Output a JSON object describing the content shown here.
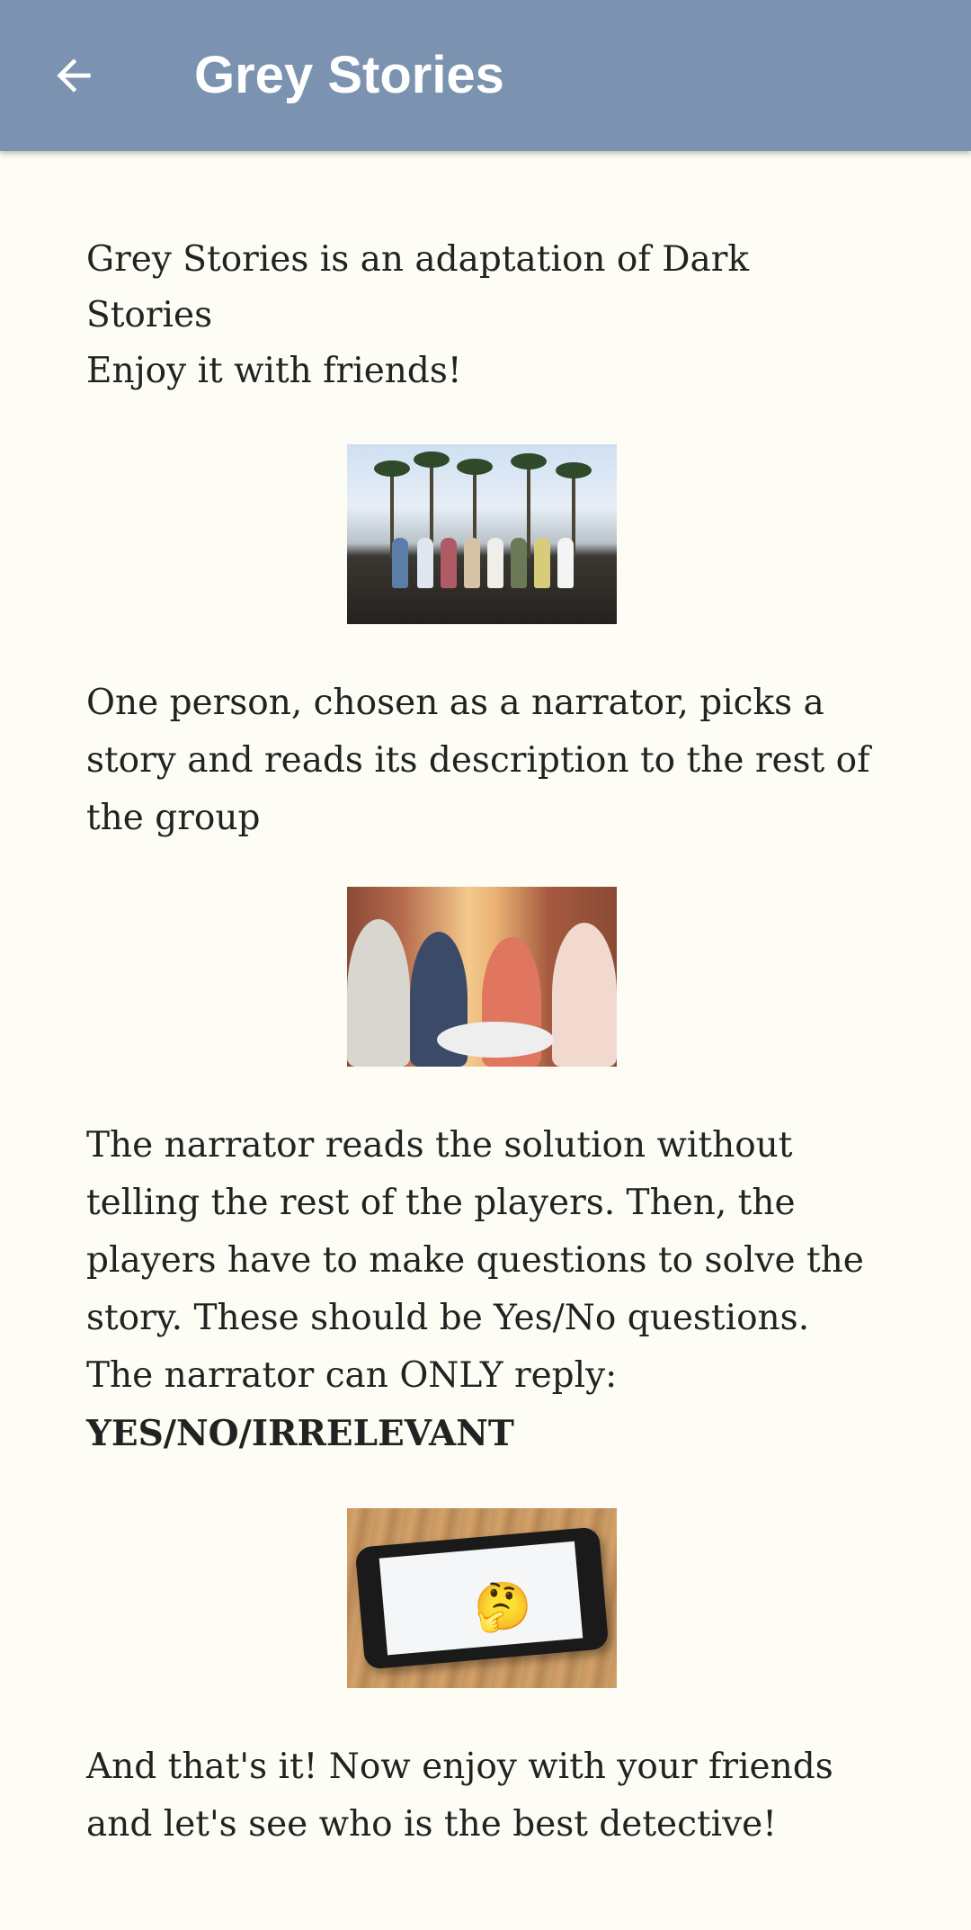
{
  "app_bar": {
    "title": "Grey Stories",
    "back_icon": "arrow-back-icon",
    "color": "#7b93b1"
  },
  "content": {
    "intro_line1": "Grey Stories is an adaptation of Dark Stories",
    "intro_line2": "Enjoy it with friends!",
    "para2": "One person, chosen as a narrator, picks a story and reads its description to the rest of the group",
    "para3": "The narrator reads the solution without telling the rest of the players. Then, the players have to make questions to solve the story. These should be Yes/No questions. The narrator can ONLY reply:",
    "para3_answer": "YES/NO/IRRELEVANT",
    "para4": "And that's it! Now enjoy with your friends and let's see who is the best detective!",
    "phone_emoji": "🤔"
  },
  "colors": {
    "background": "#fdfdf5",
    "text": "#222222"
  }
}
